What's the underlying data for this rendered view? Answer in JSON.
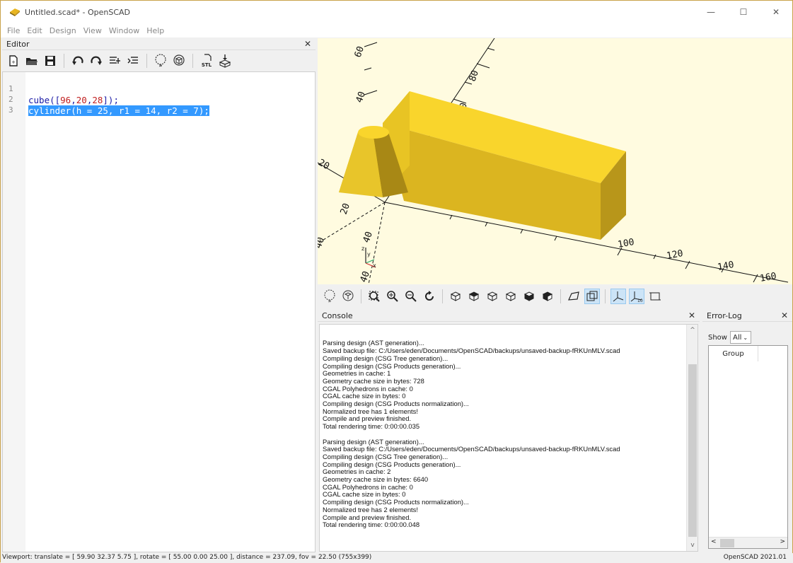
{
  "window": {
    "title": "Untitled.scad* - OpenSCAD",
    "minimize": "—",
    "maximize": "☐",
    "close": "✕"
  },
  "menu": [
    "File",
    "Edit",
    "Design",
    "View",
    "Window",
    "Help"
  ],
  "editor": {
    "title": "Editor",
    "close": "✕",
    "lines": [
      {
        "num": "1",
        "text": "cube([96,20,28]);"
      },
      {
        "num": "2",
        "text": "cylinder(h = 25, r1 = 14, r2 = 7);"
      },
      {
        "num": "3",
        "text": ""
      }
    ]
  },
  "viewport": {
    "axis_labels": {
      "z_labels": [
        "60",
        "80",
        "40",
        "20"
      ],
      "x_labels": [
        "100",
        "120",
        "140",
        "160"
      ],
      "y_labels": [
        "20",
        "40",
        "60",
        "20",
        "40"
      ],
      "axis_indicator": [
        "z",
        "y",
        "x"
      ]
    },
    "object_color": "#f9d52c",
    "background": "#fffbe0"
  },
  "console": {
    "title": "Console",
    "close": "✕",
    "text": "\n\nParsing design (AST generation)...\nSaved backup file: C:/Users/eden/Documents/OpenSCAD/backups/unsaved-backup-fRKUnMLV.scad\nCompiling design (CSG Tree generation)...\nCompiling design (CSG Products generation)...\nGeometries in cache: 1\nGeometry cache size in bytes: 728\nCGAL Polyhedrons in cache: 0\nCGAL cache size in bytes: 0\nCompiling design (CSG Products normalization)...\nNormalized tree has 1 elements!\nCompile and preview finished.\nTotal rendering time: 0:00:00.035\n\nParsing design (AST generation)...\nSaved backup file: C:/Users/eden/Documents/OpenSCAD/backups/unsaved-backup-fRKUnMLV.scad\nCompiling design (CSG Tree generation)...\nCompiling design (CSG Products generation)...\nGeometries in cache: 2\nGeometry cache size in bytes: 6640\nCGAL Polyhedrons in cache: 0\nCGAL cache size in bytes: 0\nCompiling design (CSG Products normalization)...\nNormalized tree has 2 elements!\nCompile and preview finished.\nTotal rendering time: 0:00:00.048"
  },
  "errorlog": {
    "title": "Error-Log",
    "close": "✕",
    "show_label": "Show",
    "show_value": "All",
    "column": "Group"
  },
  "statusbar": {
    "viewport": "Viewport: translate = [ 59.90 32.37 5.75 ], rotate = [ 55.00 0.00 25.00 ], distance = 237.09, fov = 22.50 (755x399)",
    "version": "OpenSCAD 2021.01"
  }
}
